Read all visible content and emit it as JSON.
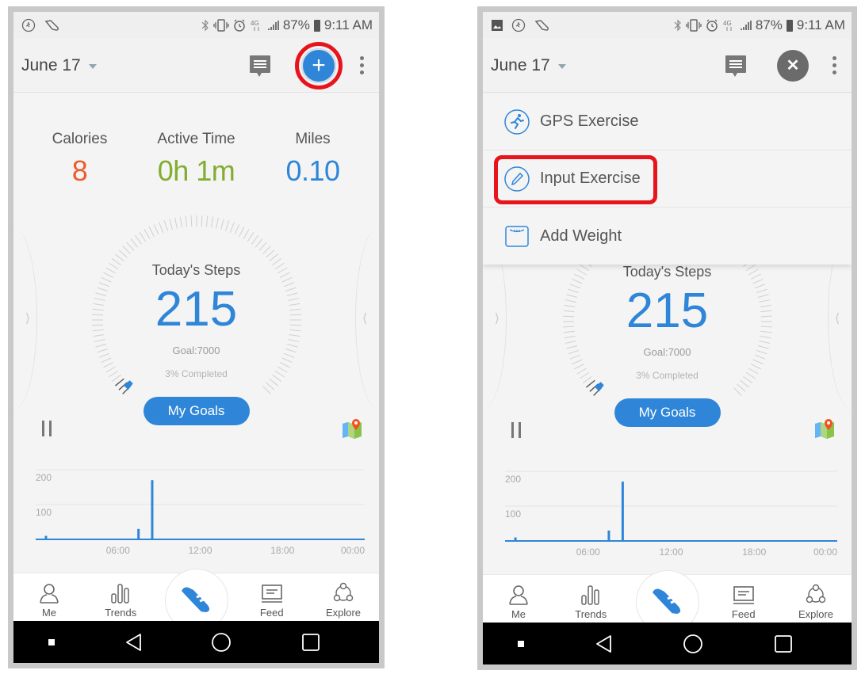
{
  "phones": [
    {
      "id": "left",
      "status_bar": {
        "left_icons": [
          "activity-icon",
          "shoe-icon"
        ],
        "right_icons": [
          "bluetooth-icon",
          "vibrate-icon",
          "alarm-icon",
          "4g-lte-icon",
          "signal-icon"
        ],
        "battery": "87%",
        "time": "9:11 AM"
      },
      "header": {
        "date": "June 17",
        "fab_icon": "plus-icon",
        "fab_highlighted": true
      },
      "stats": [
        {
          "label": "Calories",
          "value": "8",
          "color": "#ec5b2c"
        },
        {
          "label": "Active Time",
          "value": "0h 1m",
          "color": "#82ad2e"
        },
        {
          "label": "Miles",
          "value": "0.10",
          "color": "#2f86d8"
        }
      ]
    },
    {
      "id": "right",
      "status_bar": {
        "left_icons": [
          "image-icon",
          "activity-icon",
          "shoe-icon"
        ],
        "right_icons": [
          "bluetooth-icon",
          "vibrate-icon",
          "alarm-icon",
          "4g-lte-icon",
          "signal-icon"
        ],
        "battery": "87%",
        "time": "9:11 AM"
      },
      "header": {
        "date": "June 17",
        "fab_icon": "close-icon",
        "fab_highlighted": false
      },
      "menu": [
        {
          "label": "GPS Exercise",
          "icon": "running-icon",
          "highlighted": false
        },
        {
          "label": "Input Exercise",
          "icon": "pencil-icon",
          "highlighted": true
        },
        {
          "label": "Add Weight",
          "icon": "scale-icon",
          "highlighted": false
        }
      ]
    }
  ],
  "steps": {
    "title": "Today's Steps",
    "value": "215",
    "goal": "Goal:7000",
    "completed": "3% Completed",
    "progress_fraction": 0.03,
    "goals_button": "My Goals"
  },
  "nav": {
    "items": [
      {
        "label": "Me",
        "icon": "person-icon"
      },
      {
        "label": "Trends",
        "icon": "bar-chart-icon"
      },
      {
        "label": "",
        "icon": "shoe-icon"
      },
      {
        "label": "Feed",
        "icon": "feed-icon"
      },
      {
        "label": "Explore",
        "icon": "explore-icon"
      }
    ]
  },
  "chart_data": {
    "type": "bar",
    "title": "",
    "xlabel": "",
    "ylabel": "",
    "ylim": [
      0,
      200
    ],
    "yticks": [
      "100",
      "200"
    ],
    "xticks": [
      "06:00",
      "12:00",
      "18:00",
      "00:00"
    ],
    "xrange_hours": [
      0,
      24
    ],
    "grid": true,
    "color": "#2f86d8",
    "bars": [
      {
        "hour": 0.75,
        "value": 10
      },
      {
        "hour": 7.0,
        "value": 2
      },
      {
        "hour": 7.5,
        "value": 30
      },
      {
        "hour": 8.0,
        "value": 2
      },
      {
        "hour": 8.5,
        "value": 170
      }
    ]
  }
}
